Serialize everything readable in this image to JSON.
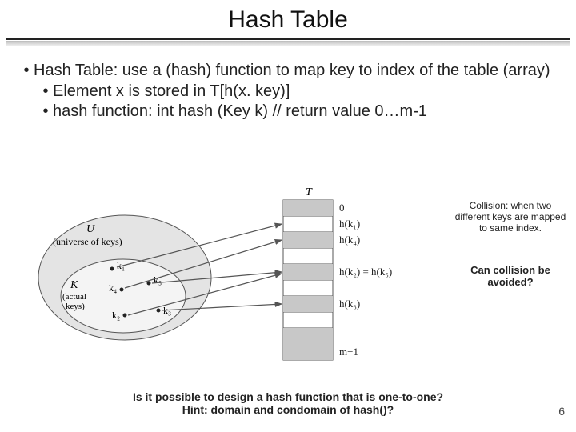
{
  "title": "Hash Table",
  "bullets": {
    "b1": "Hash Table: use a (hash) function to map key to index of the table (array)",
    "b2": "Element x is stored in T[h(x. key)]",
    "b3": "hash function: int hash (Key k) // return value 0…m-1"
  },
  "diagram": {
    "T": "T",
    "U_line1": "U",
    "U_line2": "(universe of keys)",
    "K_line1": "K",
    "K_line2": "(actual",
    "K_line3": "keys)",
    "k1": "k₁",
    "k2": "k₂",
    "k3": "k₃",
    "k4": "k₄",
    "k5": "k₅",
    "idx0": "0",
    "hk1": "h(k₁)",
    "hk4": "h(k₄)",
    "hk25": "h(k₂) = h(k₅)",
    "hk3": "h(k₃)",
    "m1": "m−1"
  },
  "notes": {
    "collision_u": "Collision",
    "collision_rest": ": when two different keys are mapped to same index.",
    "q1": "Can collision be avoided?"
  },
  "bottom": {
    "line1": "Is it possible to design a hash function that is one-to-one?",
    "line2": "Hint: domain and condomain of hash()?"
  },
  "page": "6",
  "glyphs": {
    "bullet": "•"
  }
}
